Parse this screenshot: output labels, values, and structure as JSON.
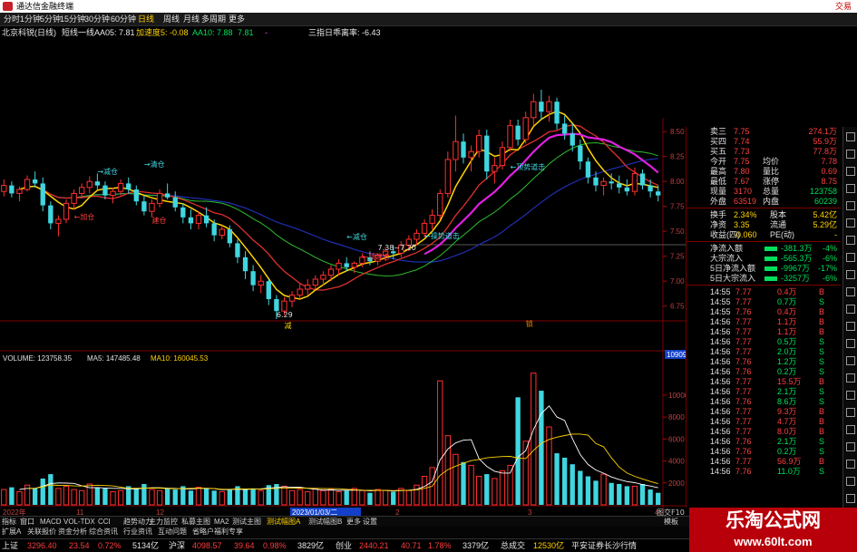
{
  "window": {
    "title": "通达信金融终端",
    "right_label": "交易"
  },
  "menu": [
    "分时",
    "1分钟",
    "5分钟",
    "15分钟",
    "30分钟",
    "60分钟",
    "日线",
    "周线",
    "月线",
    "多周期",
    "更多"
  ],
  "menu_active": 6,
  "quote_bar": {
    "stock": "北京科锐(日线)",
    "indicator": "短线一线",
    "aa05": "AA05: 7.81",
    "accel": "加速度5: -0.08",
    "aa10": "AA10: 7.88",
    "v4": "7.81",
    "v5": "-",
    "rate": "三指日乖离率: -6.43"
  },
  "chart_data": {
    "type": "candlestick",
    "price_axis": {
      "ticks": [
        6.75,
        7.0,
        7.25,
        7.5,
        7.75,
        8.0,
        8.25,
        8.5
      ],
      "ylim": [
        6.62,
        8.62
      ]
    },
    "volume_axis": {
      "ticks": [
        2000,
        4000,
        6000,
        8000,
        10000
      ],
      "ylim": [
        0,
        12800
      ],
      "current_label": "10909"
    },
    "x_axis_labels": [
      "2022年",
      "11",
      "12",
      "2023/01/03/二",
      "2",
      "3",
      "4"
    ],
    "candles": [
      [
        7.9,
        8.02,
        7.85,
        7.96
      ],
      [
        7.96,
        8.0,
        7.84,
        7.88
      ],
      [
        7.88,
        7.95,
        7.8,
        7.92
      ],
      [
        7.92,
        8.06,
        7.9,
        8.02
      ],
      [
        8.02,
        8.1,
        7.94,
        7.98
      ],
      [
        7.98,
        8.04,
        7.7,
        7.76
      ],
      [
        7.76,
        7.8,
        7.52,
        7.58
      ],
      [
        7.58,
        7.66,
        7.45,
        7.62
      ],
      [
        7.62,
        7.82,
        7.58,
        7.78
      ],
      [
        7.78,
        7.92,
        7.72,
        7.88
      ],
      [
        7.88,
        7.98,
        7.84,
        7.94
      ],
      [
        7.94,
        8.05,
        7.88,
        8.0
      ],
      [
        8.0,
        8.08,
        7.92,
        7.96
      ],
      [
        7.96,
        8.0,
        7.82,
        7.86
      ],
      [
        7.86,
        7.94,
        7.78,
        7.9
      ],
      [
        7.9,
        8.02,
        7.86,
        7.98
      ],
      [
        7.98,
        8.04,
        7.88,
        7.92
      ],
      [
        7.92,
        7.96,
        7.76,
        7.8
      ],
      [
        7.8,
        7.86,
        7.66,
        7.7
      ],
      [
        7.7,
        7.82,
        7.64,
        7.78
      ],
      [
        7.78,
        7.92,
        7.74,
        7.88
      ],
      [
        7.88,
        7.98,
        7.82,
        7.84
      ],
      [
        7.84,
        7.9,
        7.7,
        7.74
      ],
      [
        7.74,
        7.78,
        7.58,
        7.64
      ],
      [
        7.64,
        7.72,
        7.52,
        7.58
      ],
      [
        7.58,
        7.7,
        7.52,
        7.66
      ],
      [
        7.66,
        7.74,
        7.54,
        7.58
      ],
      [
        7.58,
        7.62,
        7.4,
        7.46
      ],
      [
        7.46,
        7.56,
        7.42,
        7.52
      ],
      [
        7.52,
        7.56,
        7.34,
        7.38
      ],
      [
        7.38,
        7.42,
        7.18,
        7.24
      ],
      [
        7.24,
        7.3,
        7.02,
        7.1
      ],
      [
        7.1,
        7.16,
        6.9,
        6.96
      ],
      [
        6.96,
        7.06,
        6.88,
        7.0
      ],
      [
        7.0,
        7.02,
        6.76,
        6.82
      ],
      [
        6.82,
        6.86,
        6.62,
        6.7
      ],
      [
        6.7,
        6.84,
        6.66,
        6.8
      ],
      [
        6.8,
        6.9,
        6.74,
        6.86
      ],
      [
        6.86,
        6.98,
        6.82,
        6.92
      ],
      [
        6.92,
        7.02,
        6.86,
        6.96
      ],
      [
        6.96,
        7.06,
        6.92,
        7.02
      ],
      [
        7.02,
        7.1,
        6.96,
        7.06
      ],
      [
        7.06,
        7.16,
        7.0,
        7.12
      ],
      [
        7.12,
        7.22,
        7.06,
        7.18
      ],
      [
        7.18,
        7.24,
        7.1,
        7.14
      ],
      [
        7.14,
        7.2,
        7.08,
        7.18
      ],
      [
        7.18,
        7.28,
        7.14,
        7.24
      ],
      [
        7.24,
        7.3,
        7.16,
        7.2
      ],
      [
        7.2,
        7.28,
        7.16,
        7.26
      ],
      [
        7.26,
        7.34,
        7.2,
        7.3
      ],
      [
        7.3,
        7.36,
        7.22,
        7.28
      ],
      [
        7.28,
        7.4,
        7.24,
        7.36
      ],
      [
        7.36,
        7.46,
        7.3,
        7.42
      ],
      [
        7.42,
        7.52,
        7.36,
        7.48
      ],
      [
        7.48,
        7.62,
        7.44,
        7.58
      ],
      [
        7.58,
        7.72,
        7.52,
        7.66
      ],
      [
        7.66,
        7.92,
        7.62,
        7.88
      ],
      [
        7.88,
        8.3,
        7.84,
        8.22
      ],
      [
        8.22,
        8.66,
        8.1,
        8.4
      ],
      [
        8.4,
        8.48,
        8.18,
        8.24
      ],
      [
        8.24,
        8.36,
        8.1,
        8.3
      ],
      [
        8.3,
        8.52,
        8.24,
        8.46
      ],
      [
        8.46,
        8.52,
        8.02,
        8.1
      ],
      [
        8.1,
        8.24,
        7.98,
        8.16
      ],
      [
        8.16,
        8.4,
        8.12,
        8.34
      ],
      [
        8.34,
        8.62,
        8.3,
        8.56
      ],
      [
        8.56,
        8.62,
        8.36,
        8.42
      ],
      [
        8.42,
        8.7,
        8.38,
        8.64
      ],
      [
        8.64,
        8.88,
        8.56,
        8.8
      ],
      [
        8.8,
        8.92,
        8.62,
        8.7
      ],
      [
        8.7,
        8.86,
        8.6,
        8.8
      ],
      [
        8.8,
        8.84,
        8.52,
        8.58
      ],
      [
        8.58,
        8.66,
        8.42,
        8.48
      ],
      [
        8.48,
        8.58,
        8.3,
        8.36
      ],
      [
        8.36,
        8.42,
        8.12,
        8.2
      ],
      [
        8.2,
        8.24,
        7.98,
        8.04
      ],
      [
        8.04,
        8.1,
        7.9,
        7.96
      ],
      [
        7.96,
        8.04,
        7.86,
        8.0
      ],
      [
        8.0,
        8.08,
        7.92,
        7.98
      ],
      [
        7.98,
        8.06,
        7.88,
        7.94
      ],
      [
        7.94,
        8.02,
        7.86,
        7.9
      ],
      [
        7.9,
        8.14,
        7.86,
        8.08
      ],
      [
        8.08,
        8.12,
        7.92,
        7.96
      ],
      [
        7.96,
        8.02,
        7.84,
        7.9
      ],
      [
        7.9,
        7.96,
        7.8,
        7.86
      ]
    ],
    "volume": [
      1400,
      1600,
      1200,
      1800,
      1500,
      2400,
      2800,
      1500,
      1700,
      1400,
      1300,
      1900,
      1600,
      1500,
      1200,
      1300,
      1700,
      1500,
      1900,
      1400,
      1300,
      1500,
      1400,
      1700,
      1300,
      1600,
      1500,
      1300,
      1200,
      1400,
      1700,
      1400,
      1500,
      1300,
      1800,
      1900,
      1700,
      1300,
      1400,
      1200,
      1500,
      1300,
      1400,
      1200,
      1300,
      1500,
      1300,
      1100,
      1400,
      1300,
      1200,
      1500,
      1300,
      1800,
      2600,
      3400,
      11300,
      6300,
      4600,
      3900,
      3600,
      2600,
      2800,
      2400,
      3100,
      3600,
      9800,
      5800,
      12000,
      10400,
      7100,
      4700,
      4300,
      3700,
      3100,
      2600,
      2200,
      2800,
      2000,
      1900,
      1700,
      1700,
      1900,
      1400,
      1100
    ],
    "ma_lines": {
      "short": "yellow",
      "medium": "red/green",
      "long": "blue",
      "trend": "magenta"
    },
    "annotations": [
      "→减仓",
      "→清仓",
      "←加仓",
      "建仓",
      "←减仓",
      "7.38~7.20",
      "←顶建仓",
      "←操势道击",
      "←顶势道击",
      "6.29",
      "减",
      "锁"
    ]
  },
  "volume_header": {
    "label": "VOLUME: 123758.35",
    "ma5": "MA5: 147485.48",
    "ma10": "MA10: 160045.53"
  },
  "quote_panel": {
    "rows1": [
      {
        "l": "卖三",
        "v": "7.75",
        "r": "274.1万"
      },
      {
        "l": "买四",
        "v": "7.74",
        "r": "55.9万"
      },
      {
        "l": "买五",
        "v": "7.73",
        "r": "77.8万"
      },
      {
        "l": "今开",
        "v": "7.75",
        "l2": "均价",
        "r": "7.78"
      },
      {
        "l": "最高",
        "v": "7.80",
        "l2": "量比",
        "r": "0.69"
      },
      {
        "l": "最低",
        "v": "7.67",
        "l2": "涨停",
        "r": "8.75"
      },
      {
        "l": "现量",
        "v": "3170",
        "l2": "总量",
        "r": "123758"
      },
      {
        "l": "外盘",
        "v": "63519",
        "l2": "内盘",
        "r": "60239"
      }
    ],
    "rows2": [
      {
        "l": "换手",
        "v": "2.34%",
        "l2": "股本",
        "r": "5.42亿"
      },
      {
        "l": "净资",
        "v": "3.35",
        "l2": "流通",
        "r": "5.29亿"
      },
      {
        "l": "收益(四)",
        "v": "-0.060",
        "l2": "PE(动)",
        "r": "-"
      }
    ],
    "flows": [
      {
        "l": "净流入额",
        "v": "-381.3万",
        "p": "-4%"
      },
      {
        "l": "大宗流入",
        "v": "-565.3万",
        "p": "-6%"
      },
      {
        "l": "5日净流入额",
        "v": "-9967万",
        "p": "-17%"
      },
      {
        "l": "5日大宗流入",
        "v": "-3257万",
        "p": "-6%"
      }
    ],
    "ticks": [
      [
        "14:55",
        "7.77",
        "0.4万",
        "B"
      ],
      [
        "14:55",
        "7.77",
        "0.7万",
        "S"
      ],
      [
        "14:55",
        "7.76",
        "0.4万",
        "B"
      ],
      [
        "14:56",
        "7.77",
        "1.1万",
        "B"
      ],
      [
        "14:56",
        "7.77",
        "1.1万",
        "B"
      ],
      [
        "14:56",
        "7.77",
        "0.5万",
        "S"
      ],
      [
        "14:56",
        "7.77",
        "2.0万",
        "S"
      ],
      [
        "14:56",
        "7.76",
        "1.2万",
        "S"
      ],
      [
        "14:56",
        "7.76",
        "0.2万",
        "S"
      ],
      [
        "14:56",
        "7.77",
        "15.5万",
        "B"
      ],
      [
        "14:56",
        "7.77",
        "2.1万",
        "S"
      ],
      [
        "14:56",
        "7.76",
        "8.6万",
        "S"
      ],
      [
        "14:56",
        "7.77",
        "9.3万",
        "B"
      ],
      [
        "14:56",
        "7.77",
        "4.7万",
        "B"
      ],
      [
        "14:56",
        "7.77",
        "8.0万",
        "B"
      ],
      [
        "14:56",
        "7.76",
        "2.1万",
        "S"
      ],
      [
        "14:56",
        "7.76",
        "0.2万",
        "S"
      ],
      [
        "14:56",
        "7.77",
        "56.9万",
        "B"
      ],
      [
        "14:56",
        "7.76",
        "11.0万",
        "S"
      ]
    ]
  },
  "bottom_tabs": [
    "指标",
    "窗口",
    "MACD",
    "VOL-TDX",
    "CCI",
    "趋势动力",
    "主力监控",
    "私募主图",
    "MA2",
    "测试主图",
    "测试幅图A",
    "测试幅图B",
    "更多",
    "设置"
  ],
  "bottom_tabs_active": 10,
  "bottom_tabs_right": "模板",
  "sub_bar": [
    "扩展A",
    "关联报价",
    "资金分析",
    "综合资讯",
    "行业资讯",
    "互动问题",
    "省略户福利专享"
  ],
  "index_bar": {
    "sh_label": "上证",
    "sh_val": "3296.40",
    "sh_chg": "23.54",
    "sh_pct": "0.72%",
    "sh_amt": "5134亿",
    "sz_label": "沪深",
    "sz_val": "4098.57",
    "sz_chg": "39.64",
    "sz_pct": "0.98%",
    "sz_amt": "3829亿",
    "cy_label": "创业",
    "cy_val": "2440.21",
    "cy_chg": "40.71",
    "cy_pct": "1.78%",
    "cy_amt": "3379亿",
    "tot_label": "总成交",
    "tot_val": "12530亿",
    "note": "平安证券长沙行情"
  },
  "chart_bottom_right": "图交F10",
  "watermark": {
    "title": "乐淘公式网",
    "url": "www.60lt.com"
  }
}
